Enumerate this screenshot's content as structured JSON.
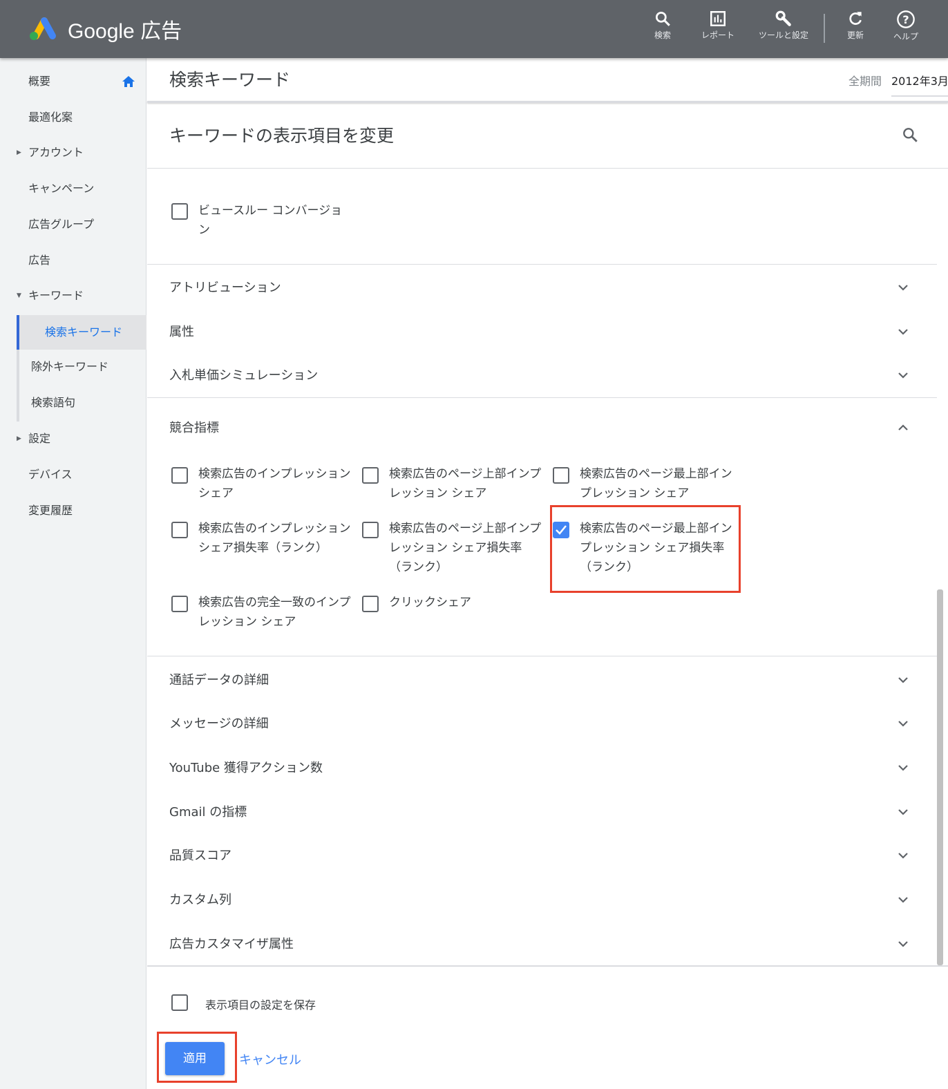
{
  "header": {
    "brand": "Google 広告",
    "actions": [
      {
        "label": "検索",
        "icon": "search-icon"
      },
      {
        "label": "レポート",
        "icon": "report-icon"
      },
      {
        "label": "ツールと設定",
        "icon": "wrench-icon"
      },
      {
        "label": "更新",
        "icon": "refresh-icon"
      },
      {
        "label": "ヘルプ",
        "icon": "help-icon"
      }
    ]
  },
  "sidebar": {
    "items": [
      {
        "label": "概要"
      },
      {
        "label": "最適化案"
      },
      {
        "label": "アカウント"
      },
      {
        "label": "キャンペーン"
      },
      {
        "label": "広告グループ"
      },
      {
        "label": "広告"
      },
      {
        "label": "キーワード"
      },
      {
        "label": "検索キーワード"
      },
      {
        "label": "除外キーワード"
      },
      {
        "label": "検索語句"
      },
      {
        "label": "設定"
      },
      {
        "label": "デバイス"
      },
      {
        "label": "変更履歴"
      }
    ]
  },
  "page": {
    "title": "検索キーワード",
    "date_label": "全期間",
    "date_value": "2012年3月"
  },
  "panel": {
    "title": "キーワードの表示項目を変更",
    "top_option": "ビュースルー コンバージョン",
    "sections_a": [
      "アトリビューション",
      "属性",
      "入札単価シミュレーション"
    ],
    "competitive": {
      "title": "競合指標",
      "options": [
        {
          "label": "検索広告のインプレッション シェア",
          "checked": false
        },
        {
          "label": "検索広告のページ上部インプレッション シェア",
          "checked": false
        },
        {
          "label": "検索広告のページ最上部インプレッション シェア",
          "checked": false
        },
        {
          "label": "検索広告のインプレッション シェア損失率（ランク）",
          "checked": false
        },
        {
          "label": "検索広告のページ上部インプレッション シェア損失率（ランク）",
          "checked": false
        },
        {
          "label": "検索広告のページ最上部インプレッション シェア損失率（ランク）",
          "checked": true
        },
        {
          "label": "検索広告の完全一致のインプレッション シェア",
          "checked": false
        },
        {
          "label": "クリックシェア",
          "checked": false
        }
      ]
    },
    "sections_b": [
      "通話データの詳細",
      "メッセージの詳細",
      "YouTube 獲得アクション数",
      "Gmail の指標",
      "品質スコア",
      "カスタム列",
      "広告カスタマイザ属性"
    ],
    "save_label": "表示項目の設定を保存",
    "apply": "適用",
    "cancel": "キャンセル"
  },
  "colors": {
    "header": "#5f6368",
    "accent": "#4285f4",
    "highlight": "#e8412c"
  }
}
